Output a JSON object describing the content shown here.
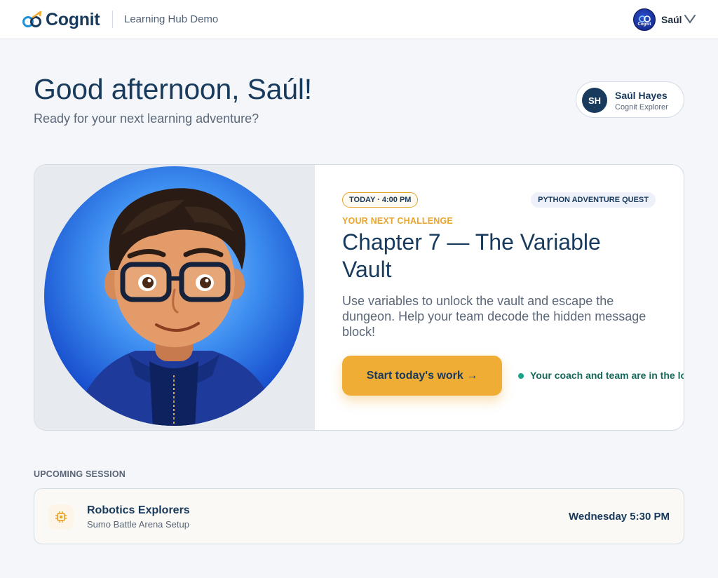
{
  "header": {
    "brand": "Cognit",
    "hub_title": "Learning Hub Demo",
    "user_name": "Saúl",
    "avatar_tiny_text": "Cognit",
    "icons": [
      "cognit-logo-icon",
      "user-avatar",
      "chevron-down-icon"
    ]
  },
  "greeting": {
    "title": "Good afternoon, Saúl!",
    "subtitle": "Ready for your next learning adventure?"
  },
  "profile": {
    "initials": "SH",
    "name": "Saúl Hayes",
    "role": "Cognit Explorer"
  },
  "challenge": {
    "time_badge": "TODAY · 4:00 PM",
    "course_badge": "PYTHON ADVENTURE QUEST",
    "eyebrow": "YOUR NEXT CHALLENGE",
    "title": "Chapter 7 — The Variable Vault",
    "description": "Use variables to unlock the vault and escape the dungeon. Help your team decode the hidden message block!",
    "cta_label": "Start today's work →",
    "status_text": "Your coach and team are in the lobby"
  },
  "upcoming": {
    "section_label": "UPCOMING SESSION",
    "title": "Robotics Explorers",
    "subtitle": "Sumo Battle Arena Setup",
    "time": "Wednesday 5:30 PM",
    "icon": "chip-icon"
  },
  "colors": {
    "navy": "#183a5d",
    "accent": "#f0ad35",
    "online": "#1aa38a",
    "background": "#f4f6f9"
  }
}
